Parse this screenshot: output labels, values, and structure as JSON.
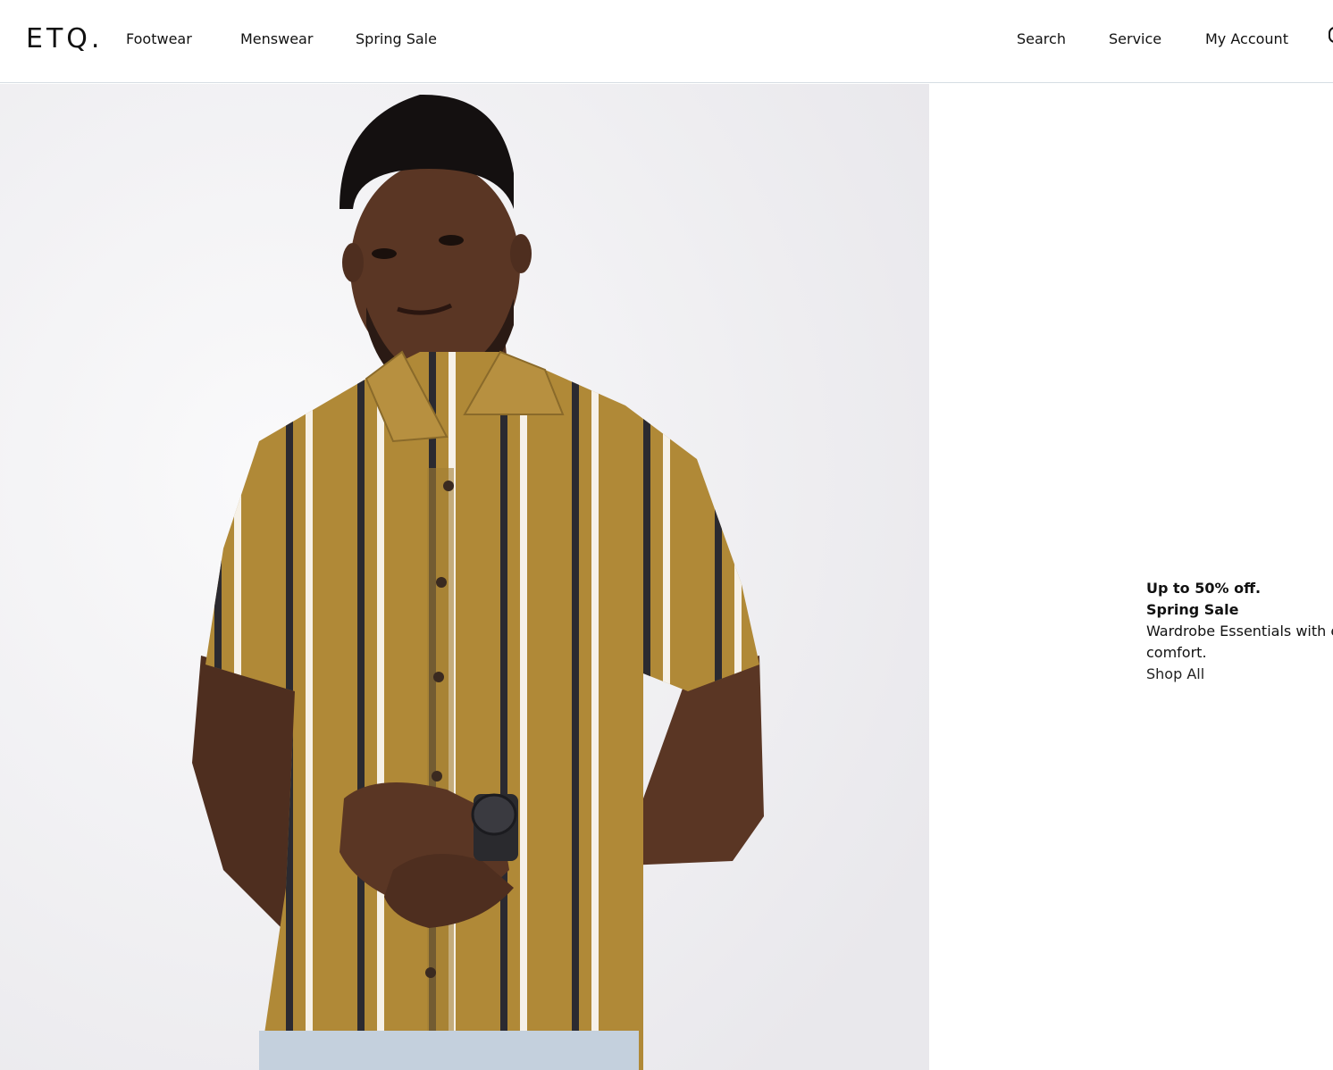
{
  "header": {
    "logo": "ETQ.",
    "nav_left": [
      {
        "label": "Footwear"
      },
      {
        "label": "Menswear"
      },
      {
        "label": "Spring Sale"
      }
    ],
    "nav_right": [
      {
        "label": "Search"
      },
      {
        "label": "Service"
      },
      {
        "label": "My Account"
      }
    ],
    "cart_icon": "bag-icon"
  },
  "hero": {
    "image": "model-striped-shirt-photo"
  },
  "promo": {
    "discount": "Up to 50% off.",
    "title": "Spring Sale",
    "description_line1": "Wardrobe Essentials with er",
    "description_line2": "comfort.",
    "cta": "Shop All"
  },
  "colors": {
    "background": "#ffffff",
    "text": "#111111",
    "header_border": "#d6dee3",
    "shirt": "#b08937",
    "skin": "#5a3624"
  }
}
